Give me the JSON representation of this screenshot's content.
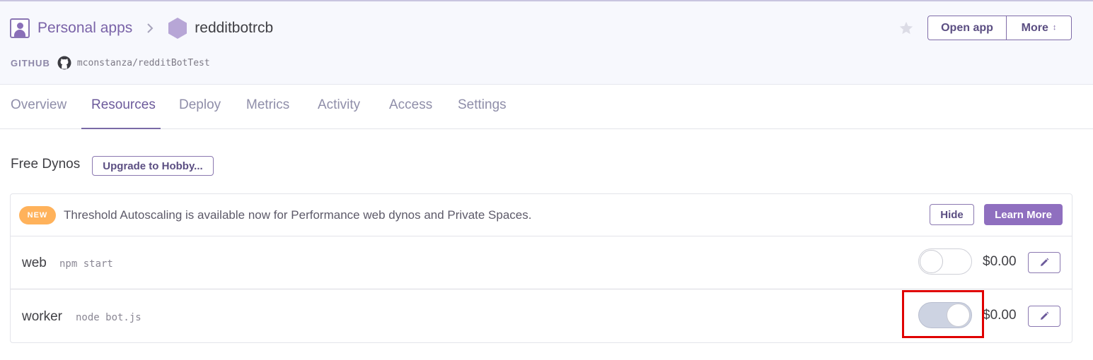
{
  "header": {
    "breadcrumb": {
      "parent": "Personal apps",
      "app": "redditbotrcb"
    },
    "github": {
      "label": "GITHUB",
      "repo": "mconstanza/redditBotTest"
    },
    "actions": {
      "open_app": "Open app",
      "more": "More"
    }
  },
  "tabs": [
    {
      "label": "Overview",
      "active": false
    },
    {
      "label": "Resources",
      "active": true
    },
    {
      "label": "Deploy",
      "active": false
    },
    {
      "label": "Metrics",
      "active": false
    },
    {
      "label": "Activity",
      "active": false
    },
    {
      "label": "Access",
      "active": false
    },
    {
      "label": "Settings",
      "active": false
    }
  ],
  "resources": {
    "dyno_type": "Free Dynos",
    "upgrade_label": "Upgrade to Hobby...",
    "notice": {
      "badge": "NEW",
      "text": "Threshold Autoscaling is available now for Performance web dynos and Private Spaces.",
      "hide_label": "Hide",
      "learn_more_label": "Learn More"
    },
    "dynos": [
      {
        "name": "web",
        "command": "npm start",
        "enabled": false,
        "cost": "$0.00"
      },
      {
        "name": "worker",
        "command": "node bot.js",
        "enabled": true,
        "cost": "$0.00"
      }
    ]
  },
  "colors": {
    "brand_purple": "#79589f",
    "new_badge": "#ffb25b",
    "highlight_box": "#e00000"
  }
}
